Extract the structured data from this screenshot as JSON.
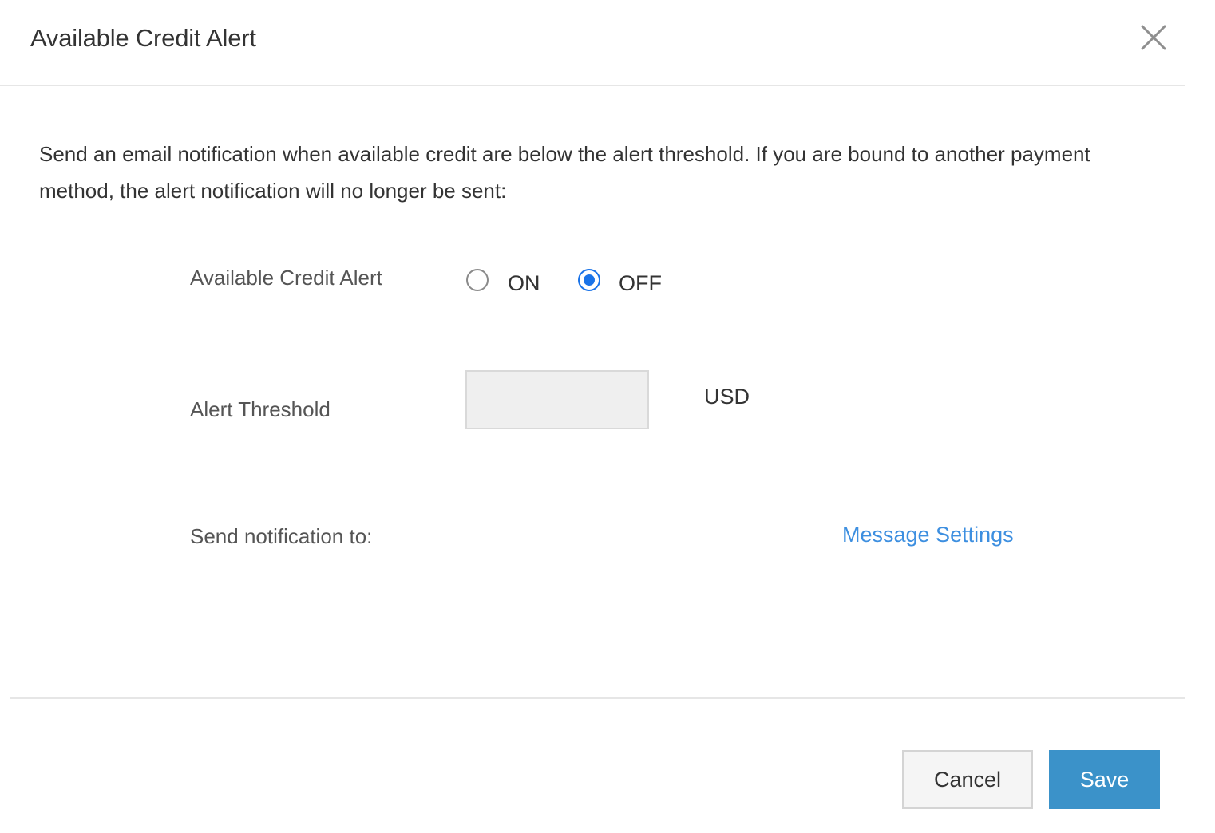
{
  "dialog": {
    "title": "Available Credit Alert",
    "close_icon": "close-icon"
  },
  "description": "Send an email notification when available credit are below the alert threshold. If you are bound to another payment method, the alert notification will no longer be sent:",
  "form": {
    "alert_toggle": {
      "label": "Available Credit Alert",
      "options": [
        "ON",
        "OFF"
      ],
      "selected": "OFF"
    },
    "threshold": {
      "label": "Alert Threshold",
      "value": "",
      "unit": "USD"
    },
    "notification": {
      "label": "Send notification to:",
      "link_text": "Message Settings"
    }
  },
  "footer": {
    "cancel_label": "Cancel",
    "save_label": "Save"
  },
  "colors": {
    "accent": "#1a73e8",
    "link": "#3d8fe0",
    "primary_button": "#3b92c9"
  }
}
